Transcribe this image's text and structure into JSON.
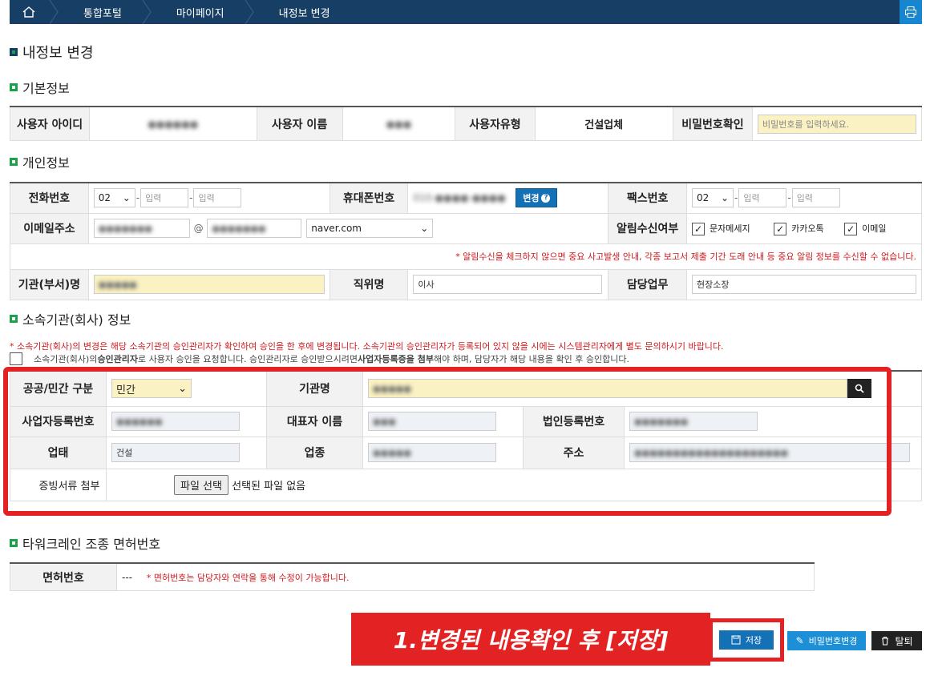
{
  "breadcrumb": {
    "items": [
      "통합포털",
      "마이페이지",
      "내정보 변경"
    ]
  },
  "page_title": "내정보 변경",
  "sections": {
    "basic": "기본정보",
    "personal": "개인정보",
    "org": "소속기관(회사) 정보",
    "license": "타워크레인 조종 면허번호"
  },
  "basic": {
    "user_id_label": "사용자 아이디",
    "user_id_value": "●●●●●●",
    "user_name_label": "사용자 이름",
    "user_name_value": "●●●",
    "user_type_label": "사용자유형",
    "user_type_value": "건설업체",
    "pw_confirm_label": "비밀번호확인",
    "pw_confirm_placeholder": "비밀번호를 입력하세요."
  },
  "personal": {
    "phone_label": "전화번호",
    "phone_area": "02",
    "phone_mid_placeholder": "입력",
    "phone_last_placeholder": "입력",
    "mobile_label": "휴대폰번호",
    "mobile_value": "010-●●●●-●●●●",
    "change_button": "변경",
    "fax_label": "팩스번호",
    "fax_area": "02",
    "fax_mid_placeholder": "입력",
    "fax_last_placeholder": "입력",
    "email_label": "이메일주소",
    "email_id": "●●●●●●●",
    "email_domain_input": "●●●●●●●",
    "email_domain_select": "naver.com",
    "notify_label": "알림수신여부",
    "notify_sms": "문자메세지",
    "notify_kakao": "카카오톡",
    "notify_email": "이메일",
    "notify_notice": "* 알림수신을 체크하지 않으면 중요 사고발생 안내, 각종 보고서 제출 기간 도래 안내 등 중요 알림 정보를 수신할 수 없습니다.",
    "dept_label": "기관(부서)명",
    "dept_value": "●●●●●",
    "position_label": "직위명",
    "position_value": "이사",
    "duty_label": "담당업무",
    "duty_value": "현장소장"
  },
  "org": {
    "notice": "* 소속기관(회사)의 변경은 해당 소속기관의 승인관리자가 확인하여 승인을 한 후에 변경됩니다. 소속기관의 승인관리자가 등록되어 있지 않을 시에는 시스템관리자에게 별도 문의하시기 바랍니다.",
    "request_pre": "소속기관(회사)의 ",
    "request_bold1": "승인관리자",
    "request_mid": "로 사용자 승인을 요청합니다. 승인관리자로 승인받으시려면 ",
    "request_bold2": "사업자등록증을 첨부",
    "request_post": "해야 하며, 담당자가 해당 내용을 확인 후 승인합니다.",
    "type_label": "공공/민간 구분",
    "type_value": "민간",
    "org_name_label": "기관명",
    "org_name_value": "●●●●●",
    "biz_no_label": "사업자등록번호",
    "biz_no_value": "●●●●●●",
    "ceo_label": "대표자 이름",
    "ceo_value": "●●●",
    "corp_no_label": "법인등록번호",
    "corp_no_value": "●●●●●●●",
    "biz_type_label": "업태",
    "biz_type_value": "건설",
    "biz_item_label": "업종",
    "biz_item_value": "●●●●●",
    "address_label": "주소",
    "address_value": "●●●●●●●●●●●●●●●●●●●●",
    "attach_label": "증빙서류 첨부",
    "file_button": "파일 선택",
    "file_status": "선택된 파일 없음"
  },
  "license": {
    "label": "면허번호",
    "value": "---",
    "notice": "* 면허번호는 담당자와 연락을 통해 수정이 가능합니다."
  },
  "callout": "1.변경된 내용확인 후 [저장]",
  "buttons": {
    "save": "저장",
    "change_pw": "비밀번호변경",
    "withdraw": "탈퇴"
  },
  "colors": {
    "navy": "#173e64",
    "green": "#1aa24a",
    "red": "#e32323",
    "blue": "#1571b6"
  }
}
